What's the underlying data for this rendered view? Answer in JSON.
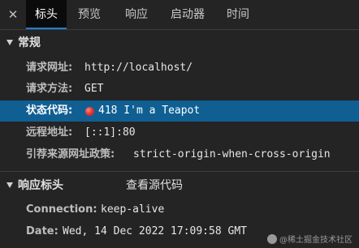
{
  "tabs": [
    {
      "label": "标头",
      "active": true
    },
    {
      "label": "预览",
      "active": false
    },
    {
      "label": "响应",
      "active": false
    },
    {
      "label": "启动器",
      "active": false
    },
    {
      "label": "时间",
      "active": false
    }
  ],
  "general": {
    "title": "常规",
    "rows": [
      {
        "key": "请求网址:",
        "value": "http://localhost/"
      },
      {
        "key": "请求方法:",
        "value": "GET"
      },
      {
        "key": "状态代码:",
        "value": "418 I'm a Teapot"
      },
      {
        "key": "远程地址:",
        "value": "[::1]:80"
      },
      {
        "key": "引荐来源网址政策:",
        "value": "strict-origin-when-cross-origin"
      }
    ]
  },
  "response_headers": {
    "title": "响应标头",
    "view_source": "查看源代码",
    "rows": [
      {
        "key": "Connection:",
        "value": "keep-alive"
      },
      {
        "key": "Date:",
        "value": "Wed, 14 Dec 2022 17:09:58 GMT"
      }
    ]
  },
  "watermark": "@稀土掘金技术社区",
  "colors": {
    "background": "#242424",
    "selected_row": "#0f5f93",
    "active_tab": "#0b0b0b",
    "status_dot": "#e53935"
  }
}
